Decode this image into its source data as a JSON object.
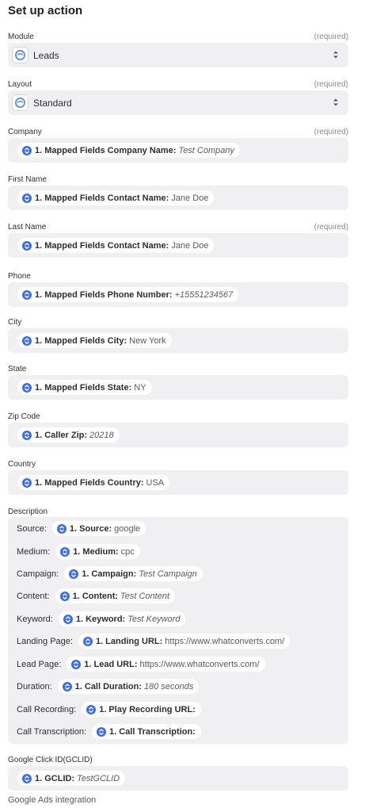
{
  "title": "Set up action",
  "required_text": "(required)",
  "module": {
    "label": "Module",
    "value": "Leads"
  },
  "layout": {
    "label": "Layout",
    "value": "Standard"
  },
  "fields": [
    {
      "label": "Company",
      "required": true,
      "pill_key": "1. Mapped Fields Company Name:",
      "pill_value": "Test Company",
      "italic": true
    },
    {
      "label": "First Name",
      "required": false,
      "pill_key": "1. Mapped Fields Contact Name:",
      "pill_value": "Jane Doe",
      "italic": false
    },
    {
      "label": "Last Name",
      "required": true,
      "pill_key": "1. Mapped Fields Contact Name:",
      "pill_value": "Jane Doe",
      "italic": false
    },
    {
      "label": "Phone",
      "required": false,
      "pill_key": "1. Mapped Fields Phone Number:",
      "pill_value": "+15551234567",
      "italic": true
    },
    {
      "label": "City",
      "required": false,
      "pill_key": "1. Mapped Fields City:",
      "pill_value": "New York",
      "italic": false
    },
    {
      "label": "State",
      "required": false,
      "pill_key": "1. Mapped Fields State:",
      "pill_value": "NY",
      "italic": false
    },
    {
      "label": "Zip Code",
      "required": false,
      "pill_key": "1. Caller Zip:",
      "pill_value": "20218",
      "italic": true
    },
    {
      "label": "Country",
      "required": false,
      "pill_key": "1. Mapped Fields Country:",
      "pill_value": "USA",
      "italic": false
    }
  ],
  "description": {
    "label": "Description",
    "rows": [
      {
        "label": "Source:",
        "pill_key": "1. Source:",
        "pill_value": "google",
        "italic": false
      },
      {
        "label": "Medium:",
        "pill_key": "1. Medium:",
        "pill_value": "cpc",
        "italic": false
      },
      {
        "label": "Campaign:",
        "pill_key": "1. Campaign:",
        "pill_value": "Test Campaign",
        "italic": true
      },
      {
        "label": "Content:",
        "pill_key": "1. Content:",
        "pill_value": "Test Content",
        "italic": true
      },
      {
        "label": "Keyword:",
        "pill_key": "1. Keyword:",
        "pill_value": "Test Keyword",
        "italic": true
      },
      {
        "label": "Landing Page:",
        "pill_key": "1. Landing URL:",
        "pill_value": "https://www.whatconverts.com/",
        "italic": false
      },
      {
        "label": "Lead Page:",
        "pill_key": "1. Lead URL:",
        "pill_value": "https://www.whatconverts.com/",
        "italic": false
      },
      {
        "label": "Duration:",
        "pill_key": "1. Call Duration:",
        "pill_value": "180 seconds",
        "italic": true
      },
      {
        "label": "Call Recording:",
        "pill_key": "1. Play Recording URL:",
        "pill_value": "",
        "italic": false
      },
      {
        "label": "Call Transcription:",
        "pill_key": "1. Call Transcription:",
        "pill_value": "",
        "italic": false
      }
    ]
  },
  "gclid": {
    "label": "Google Click ID(GCLID)",
    "pill_key": "1. GCLID:",
    "pill_value": "TestGCLID",
    "italic": true
  },
  "footer": "Google Ads integration"
}
